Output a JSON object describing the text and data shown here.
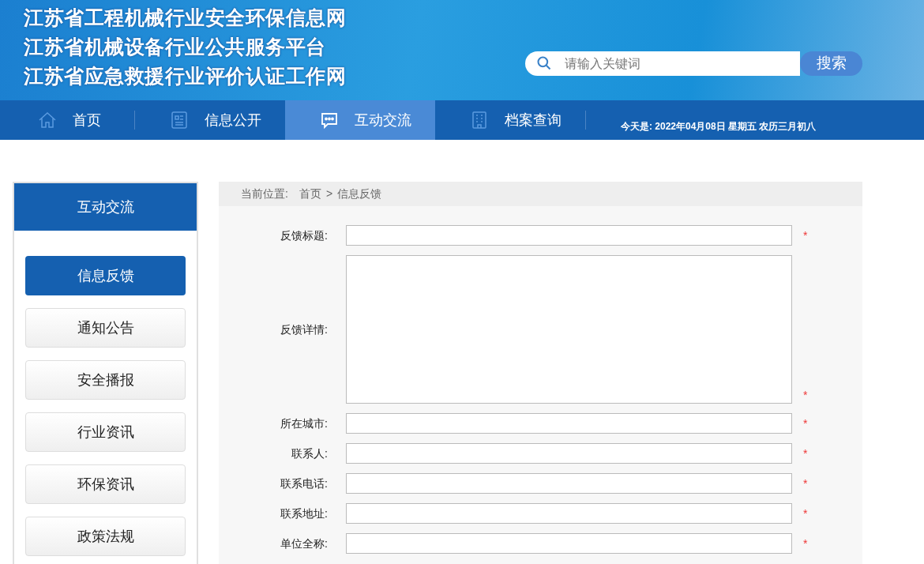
{
  "header": {
    "titles": [
      "江苏省工程机械行业安全环保信息网",
      "江苏省机械设备行业公共服务平台",
      "江苏省应急救援行业评价认证工作网"
    ],
    "search": {
      "placeholder": "请输入关键词",
      "button": "搜索"
    }
  },
  "nav": {
    "items": [
      {
        "label": "首页",
        "selected": false
      },
      {
        "label": "信息公开",
        "selected": false
      },
      {
        "label": "互动交流",
        "selected": true
      },
      {
        "label": "档案查询",
        "selected": false
      }
    ],
    "date": "今天是: 2022年04月08日 星期五 农历三月初八"
  },
  "sidebar": {
    "title": "互动交流",
    "items": [
      {
        "label": "信息反馈",
        "selected": true
      },
      {
        "label": "通知公告",
        "selected": false
      },
      {
        "label": "安全播报",
        "selected": false
      },
      {
        "label": "行业资讯",
        "selected": false
      },
      {
        "label": "环保资讯",
        "selected": false
      },
      {
        "label": "政策法规",
        "selected": false
      }
    ]
  },
  "breadcrumb": {
    "prefix": "当前位置:",
    "items": [
      "首页",
      "信息反馈"
    ],
    "separator": ">"
  },
  "form": {
    "fields": [
      {
        "kind": "input",
        "label": "反馈标题:",
        "required": true
      },
      {
        "kind": "textarea",
        "label": "反馈详情:",
        "required": true
      },
      {
        "kind": "input",
        "label": "所在城市:",
        "required": true
      },
      {
        "kind": "input",
        "label": "联系人:",
        "required": true
      },
      {
        "kind": "input",
        "label": "联系电话:",
        "required": true
      },
      {
        "kind": "input",
        "label": "联系地址:",
        "required": true
      },
      {
        "kind": "input",
        "label": "单位全称:",
        "required": true
      }
    ],
    "required_mark": "*"
  }
}
